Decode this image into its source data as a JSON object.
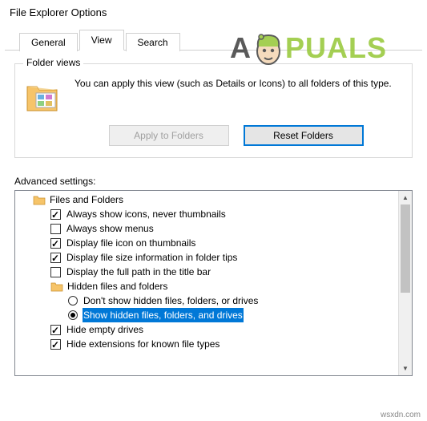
{
  "window": {
    "title": "File Explorer Options"
  },
  "tabs": [
    {
      "label": "General",
      "active": false
    },
    {
      "label": "View",
      "active": true
    },
    {
      "label": "Search",
      "active": false
    }
  ],
  "folder_views": {
    "legend": "Folder views",
    "description": "You can apply this view (such as Details or Icons) to all folders of this type.",
    "apply_btn": "Apply to Folders",
    "reset_btn": "Reset Folders"
  },
  "advanced": {
    "label": "Advanced settings:",
    "root": "Files and Folders",
    "items": [
      {
        "type": "check",
        "checked": true,
        "label": "Always show icons, never thumbnails"
      },
      {
        "type": "check",
        "checked": false,
        "label": "Always show menus"
      },
      {
        "type": "check",
        "checked": true,
        "label": "Display file icon on thumbnails"
      },
      {
        "type": "check",
        "checked": true,
        "label": "Display file size information in folder tips"
      },
      {
        "type": "check",
        "checked": false,
        "label": "Display the full path in the title bar"
      },
      {
        "type": "folder",
        "label": "Hidden files and folders"
      },
      {
        "type": "radio",
        "checked": false,
        "label": "Don't show hidden files, folders, or drives"
      },
      {
        "type": "radio",
        "checked": true,
        "label": "Show hidden files, folders, and drives",
        "selected": true
      },
      {
        "type": "check",
        "checked": true,
        "label": "Hide empty drives"
      },
      {
        "type": "check",
        "checked": true,
        "label": "Hide extensions for known file types"
      }
    ]
  },
  "watermark": {
    "a": "A",
    "puals": "PUALS"
  },
  "source": "wsxdn.com"
}
